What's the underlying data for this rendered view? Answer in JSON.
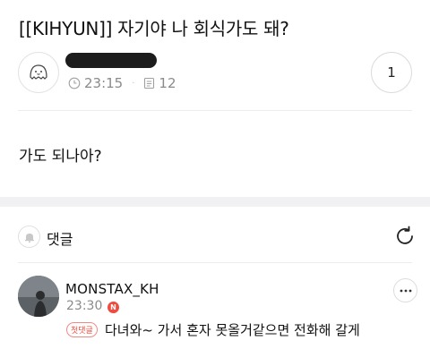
{
  "post": {
    "title": "[[KIHYUN]] 자기야 나 회식가도 돼?",
    "time": "23:15",
    "views": "12",
    "like_count": "1",
    "body": "가도 되나아?"
  },
  "comments": {
    "label": "댓글",
    "items": [
      {
        "author": "MONSTAX_KH",
        "time": "23:30",
        "new_badge": "N",
        "first_badge": "첫댓글",
        "text": "다녀와~ 가서 혼자 못올거같으면 전화해 갈게"
      }
    ]
  },
  "colors": {
    "accent_red": "#ef4b3f",
    "meta_gray": "#8a8a8a",
    "band": "#f1f1f3"
  },
  "icons": [
    "clock-icon",
    "document-icon",
    "bell-icon",
    "refresh-icon",
    "more-icon"
  ]
}
